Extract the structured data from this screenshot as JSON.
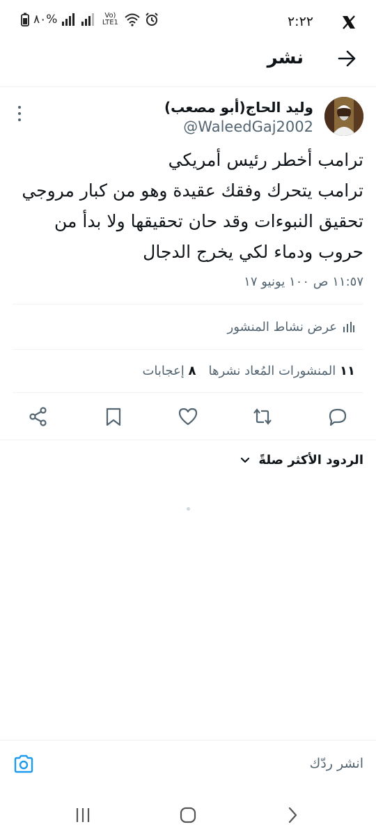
{
  "status_bar": {
    "time": "٢:٢٢",
    "battery": "٨٠%",
    "network": "Vo) LTE1"
  },
  "header": {
    "title": "نشر"
  },
  "tweet": {
    "author_name": "وليد الحاج(أبو مصعب)",
    "author_handle": "@WaleedGaj2002",
    "body_lines": [
      "ترامب أخطر رئيس أمريكي",
      "ترامب يتحرك وفقك عقيدة وهو من كبار مروجي",
      "تحقيق النبوءات وقد حان تحقيقها ولا بدأ من",
      "حروب ودماء لكي يخرج الدجال"
    ],
    "time": "١١:٥٧ ص",
    "views_sep": "١٠٠",
    "date": "يونيو ١٧",
    "timestamp_full": "١١:٥٧ ص ١٠٠ يونيو ١٧"
  },
  "activity": {
    "label": "عرض نشاط المنشور"
  },
  "stats": {
    "reposts_count": "١١",
    "reposts_label": "المنشورات المُعاد نشرها",
    "likes_count": "٨",
    "likes_label": "إعجابات"
  },
  "replies": {
    "sort_label": "الردود الأكثر صلةً"
  },
  "composer": {
    "placeholder": "انشر ردّك"
  },
  "colors": {
    "accent": "#1d9bf0",
    "text": "#0f1419",
    "muted": "#536471",
    "divider": "#eff3f4"
  }
}
